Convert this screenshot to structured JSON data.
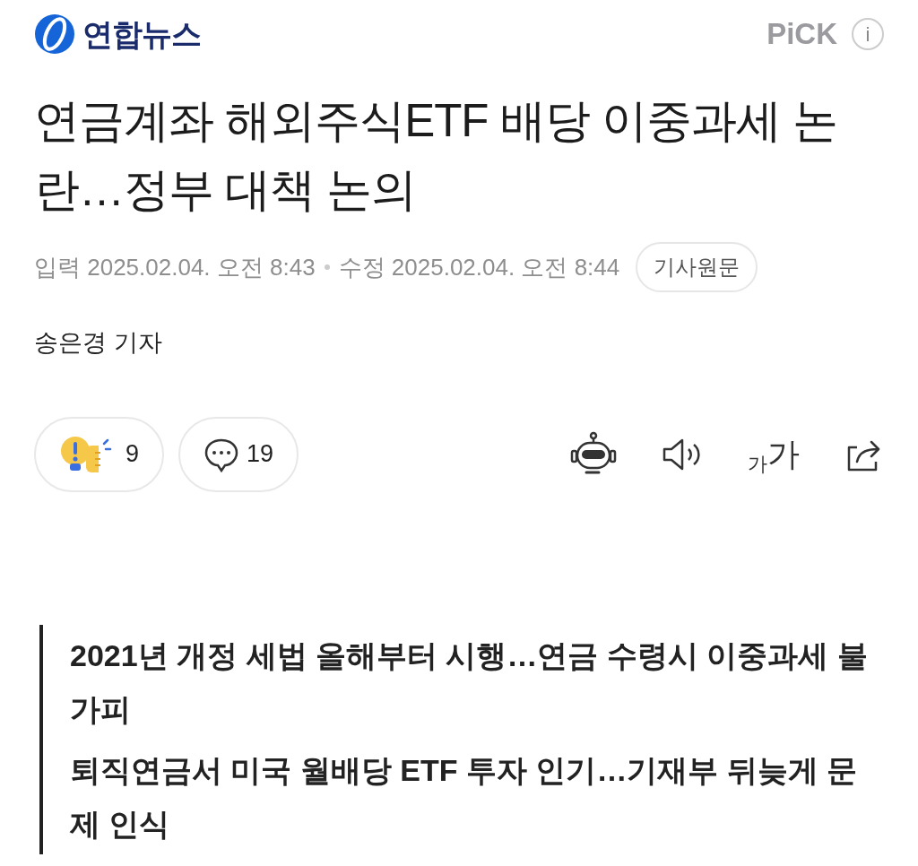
{
  "header": {
    "logo_text": "연합뉴스",
    "pick_label": "PiCK",
    "info_icon": "i"
  },
  "headline": "연금계좌 해외주식ETF 배당 이중과세 논란…정부 대책 논의",
  "meta": {
    "published_label": "입력",
    "published": "2025.02.04. 오전 8:43",
    "modified_label": "수정",
    "modified": "2025.02.04. 오전 8:44",
    "original_button": "기사원문"
  },
  "byline": "송은경 기자",
  "actions": {
    "reactions": "9",
    "comments": "19",
    "font_small": "가",
    "font_large": "가"
  },
  "subheadings": [
    "2021년 개정 세법 올해부터 시행…연금 수령시 이중과세 불가피",
    "퇴직연금서 미국 월배당 ETF 투자 인기…기재부 뒤늦게 문제 인식"
  ]
}
